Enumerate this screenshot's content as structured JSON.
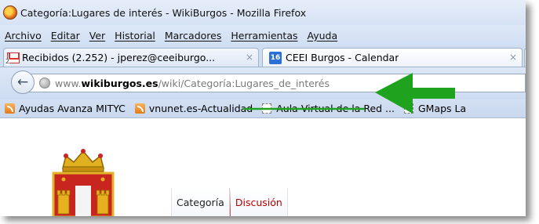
{
  "window": {
    "title": "Categoría:Lugares de interés - WikiBurgos - Mozilla Firefox"
  },
  "menu": {
    "items": [
      "Archivo",
      "Editar",
      "Ver",
      "Historial",
      "Marcadores",
      "Herramientas",
      "Ayuda"
    ]
  },
  "tabs": [
    {
      "label": "Recibidos (2.252) - jperez@ceeiburgo...",
      "close": "×",
      "icon": "gmail-icon"
    },
    {
      "label": "CEEI Burgos - Calendar",
      "close": "×",
      "icon": "calendar-icon",
      "icon_text": "16"
    }
  ],
  "navbar": {
    "url_prefix": "www.",
    "url_domain": "wikiburgos.es",
    "url_path": "/wiki/Categoría:",
    "url_highlight": "Lugares_de_interés",
    "back_glyph": "←"
  },
  "bookmarks": [
    {
      "label": "Ayudas Avanza MITYC",
      "icon": "rss-icon"
    },
    {
      "label": "vnunet.es-Actualidad",
      "icon": "rss-icon"
    },
    {
      "label": "Aula Virtual de la Red ...",
      "icon": "blank-page-icon"
    },
    {
      "label": "GMaps La",
      "icon": "blank-page-icon"
    }
  ],
  "page": {
    "tabs": [
      "Categoría",
      "Discusión"
    ]
  },
  "annotation": {
    "color": "#1fa31f"
  }
}
